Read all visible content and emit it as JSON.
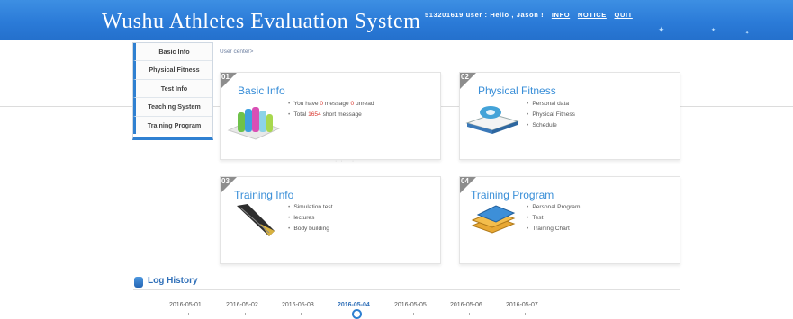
{
  "header": {
    "title": "Wushu Athletes Evaluation System",
    "user_text": "513201619 user : Hello , Jason !",
    "links": [
      "INFO",
      "NOTICE",
      "QUIT"
    ]
  },
  "sidebar": {
    "items": [
      {
        "label": "Basic Info"
      },
      {
        "label": "Physical Fitness"
      },
      {
        "label": "Test Info"
      },
      {
        "label": "Teaching System"
      },
      {
        "label": "Training Program"
      }
    ]
  },
  "breadcrumb": "User center>",
  "cards": {
    "basic": {
      "num": "01",
      "title": "Basic Info",
      "msg_prefix": "You have ",
      "msg_count": "0",
      "msg_mid": " message ",
      "msg_unread": "0",
      "msg_suffix": " unread",
      "total_prefix": "Total ",
      "total_count": "1654",
      "total_suffix": " short message"
    },
    "fitness": {
      "num": "02",
      "title": "Physical Fitness",
      "items": [
        "Personal data",
        "Physical Fitness",
        "Schedule"
      ]
    },
    "training_info": {
      "num": "03",
      "title": "Training Info",
      "items": [
        "Simulation test",
        "lectures",
        "Body building"
      ]
    },
    "training_program": {
      "num": "04",
      "title": "Training Program",
      "items": [
        "Personal Program",
        "Test",
        "Training Chart"
      ]
    }
  },
  "log_history": {
    "title": "Log History",
    "dates": [
      "2016-05-01",
      "2016-05-02",
      "2016-05-03",
      "2016-05-04",
      "2016-05-05",
      "2016-05-06",
      "2016-05-07"
    ],
    "selected": "2016-05-04"
  },
  "colors": {
    "header": "#2b7bd8",
    "accent": "#3a8fd8",
    "highlight": "#d9342b"
  }
}
